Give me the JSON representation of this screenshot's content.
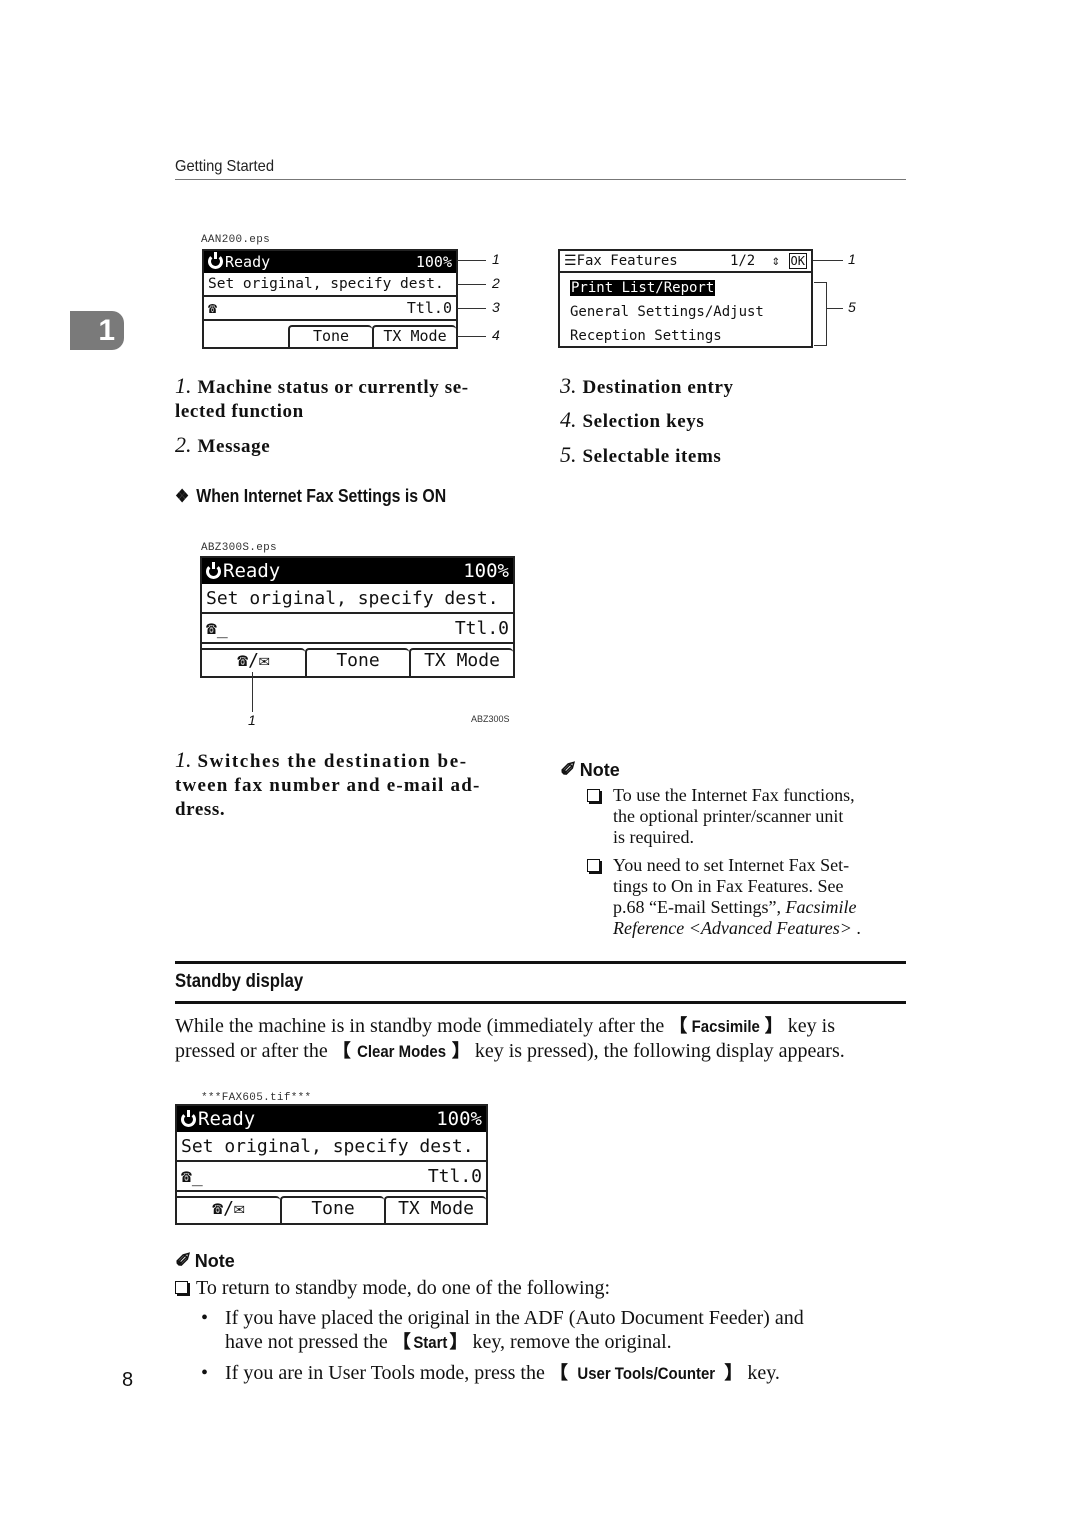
{
  "header": {
    "running_head": "Getting Started",
    "chapter_number": "1",
    "page_number": "8"
  },
  "figure1": {
    "file_label": "AAN200.eps",
    "status": "Ready",
    "zoom": "100%",
    "message": "Set original, specify dest.",
    "dest_icon": "telephone-icon",
    "total": "Ttl.0",
    "keys": [
      "",
      "Tone",
      "TX Mode"
    ],
    "callouts": [
      "1",
      "2",
      "3",
      "4"
    ]
  },
  "figure2": {
    "title": "Fax Features",
    "page": "1/2",
    "ok_label": "OK",
    "items": [
      "Print List/Report",
      "General Settings/Adjust",
      "Reception Settings"
    ],
    "selected_index": 0,
    "callouts": [
      "1",
      "5"
    ]
  },
  "legend_left": [
    {
      "num": "1.",
      "text": "Machine status or currently se-",
      "text2": "lected function"
    },
    {
      "num": "2.",
      "text": "Message"
    }
  ],
  "legend_right": [
    {
      "num": "3.",
      "text": "Destination entry"
    },
    {
      "num": "4.",
      "text": "Selection keys"
    },
    {
      "num": "5.",
      "text": "Selectable items"
    }
  ],
  "internet_fax": {
    "subheading": "When Internet Fax Settings is ON",
    "file_label": "ABZ300S.eps",
    "figure_id": "ABZ300S",
    "status": "Ready",
    "zoom": "100%",
    "message": "Set original, specify dest.",
    "dest_prefix": "☎_",
    "total": "Ttl.0",
    "keys": [
      "☎/✉",
      "Tone",
      "TX Mode"
    ],
    "callout": "1",
    "legend": {
      "num": "1.",
      "lines": [
        "Switches the destination be-",
        "tween fax number and e-mail ad-",
        "dress."
      ]
    }
  },
  "note1": {
    "title": "Note",
    "items": [
      {
        "lines": [
          "To use the Internet Fax functions,",
          "the optional printer/scanner unit",
          "is required."
        ]
      },
      {
        "lines": [
          "You need to set Internet Fax Set-",
          "tings to On in Fax Features. See"
        ],
        "ref_prefix": "p.68 “E-mail Settings”, ",
        "ref_italic_1": "Facsimile",
        "ref_italic_2": "Reference <Advanced Features>",
        "ref_suffix": " ."
      }
    ]
  },
  "standby": {
    "title": "Standby display",
    "para_1a": "While the machine is in standby mode (immediately after the ",
    "key_facsimile": "Facsimile",
    "para_1b": " key is",
    "para_2a": "pressed or after the ",
    "key_clear": "Clear Modes",
    "para_2b": " key is pressed), the following display appears.",
    "file_label": "***FAX605.tif***",
    "status": "Ready",
    "zoom": "100%",
    "message": "Set original, specify dest.",
    "dest_prefix": "☎_",
    "total": "Ttl.0",
    "keys": [
      "☎/✉",
      "Tone",
      "TX Mode"
    ]
  },
  "note2": {
    "title": "Note",
    "intro": "To return to standby mode, do one of the following:",
    "bullets": [
      {
        "line1": "If you have placed the original in the ADF (Auto Document Feeder) and",
        "line2a": "have not pressed the ",
        "key": "Start",
        "line2b": " key, remove the original."
      },
      {
        "line1a": "If you are in User Tools mode, press the ",
        "key": "User Tools/Counter",
        "line1b": " key."
      }
    ]
  },
  "brackets": {
    "open": "【",
    "close": "】"
  }
}
